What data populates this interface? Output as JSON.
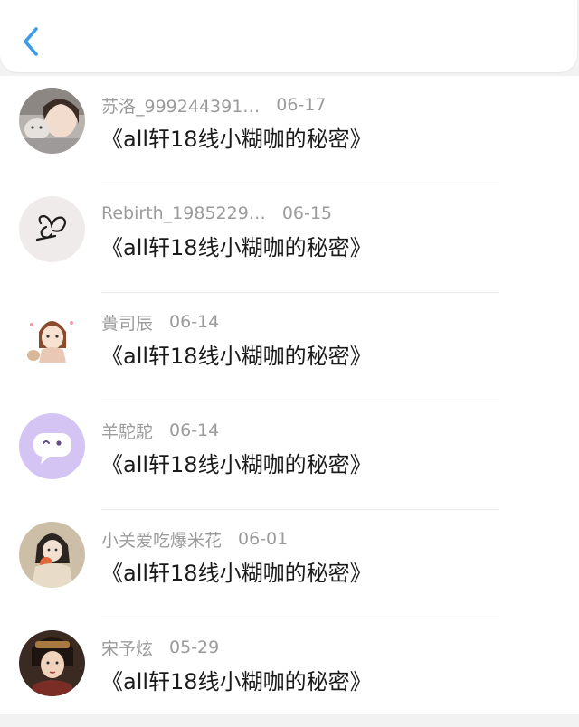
{
  "header": {
    "back_icon": "chevron-left-icon",
    "accent": "#3a9be8"
  },
  "comments": [
    {
      "name": "苏洛_999244391…",
      "date": "06-17",
      "text": "《all轩18线小糊咖的秘密》"
    },
    {
      "name": "Rebirth_1985229…",
      "date": "06-15",
      "text": "《all轩18线小糊咖的秘密》"
    },
    {
      "name": "蕢司辰",
      "date": "06-14",
      "text": "《all轩18线小糊咖的秘密》"
    },
    {
      "name": "羊駝駝",
      "date": "06-14",
      "text": "《all轩18线小糊咖的秘密》"
    },
    {
      "name": "小关爱吃爆米花",
      "date": "06-01",
      "text": "《all轩18线小糊咖的秘密》"
    },
    {
      "name": "宋予炫",
      "date": "05-29",
      "text": "《all轩18线小糊咖的秘密》"
    }
  ]
}
